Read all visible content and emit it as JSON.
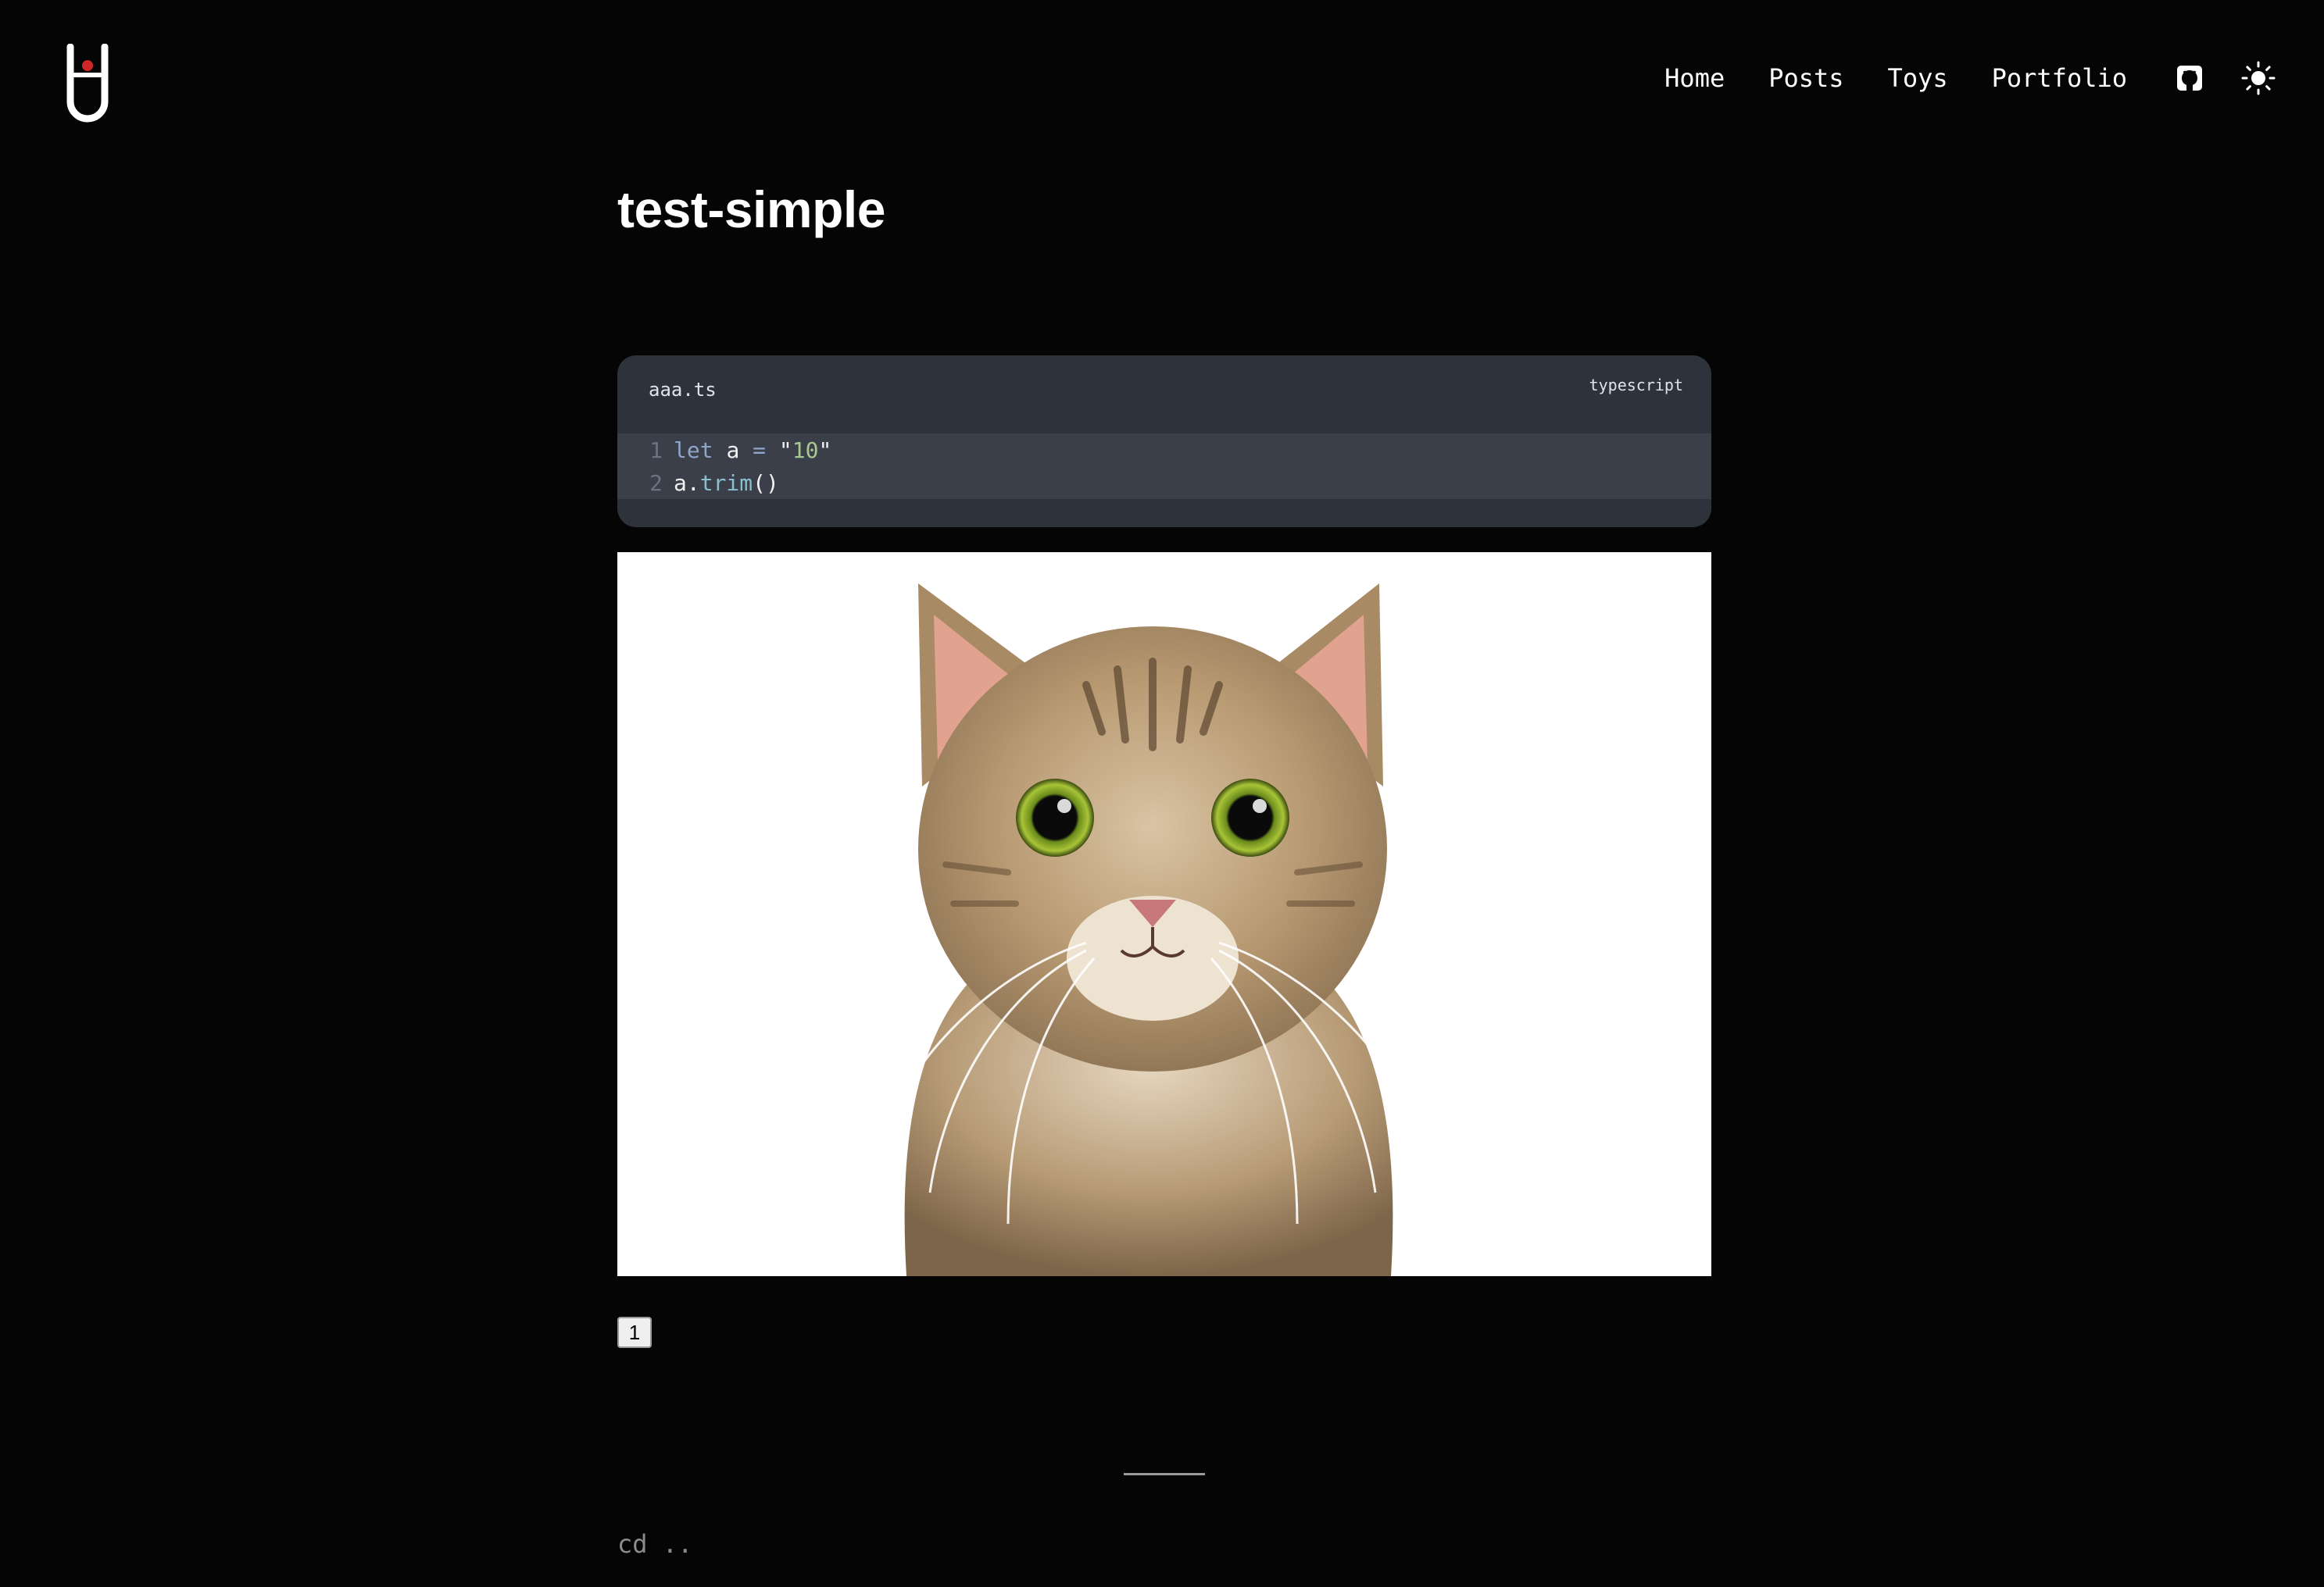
{
  "header": {
    "logo_icon": "test-tube-logo-icon",
    "nav": [
      {
        "label": "Home"
      },
      {
        "label": "Posts"
      },
      {
        "label": "Toys"
      },
      {
        "label": "Portfolio"
      }
    ],
    "github_icon": "github-icon",
    "theme_icon": "sun-icon"
  },
  "article": {
    "title": "test-simple",
    "code": {
      "filename": "aaa.ts",
      "language": "typescript",
      "lines": [
        {
          "number": "1",
          "text": "let a = \"10\""
        },
        {
          "number": "2",
          "text": "a.trim()"
        }
      ]
    },
    "image": {
      "subject": "tabby-cat-photo"
    },
    "page_badge": "1"
  },
  "footer": {
    "back_link": "cd .."
  },
  "colors": {
    "background": "#050505",
    "code_header": "#2e323b",
    "code_body": "#3a3f49",
    "accent_red": "#d0262a"
  }
}
